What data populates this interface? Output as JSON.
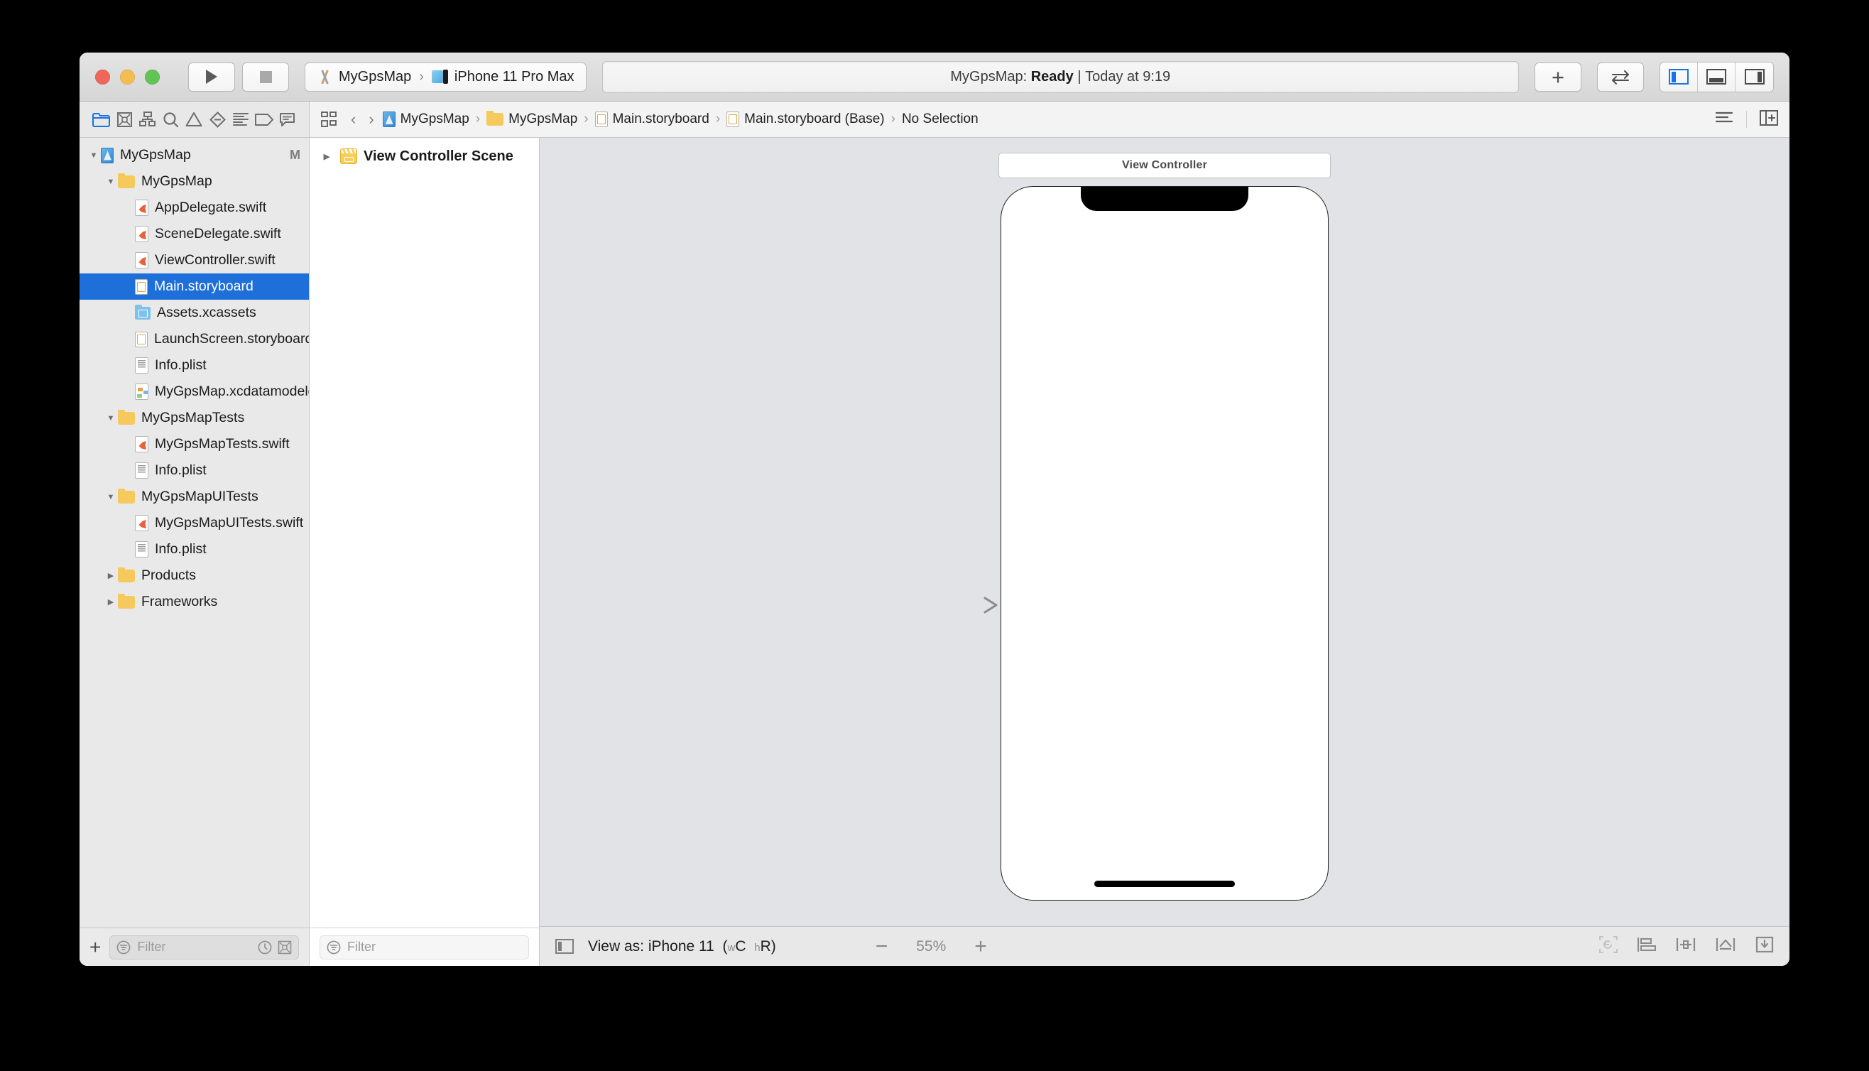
{
  "titlebar": {
    "run_button": "run",
    "stop_button": "stop",
    "scheme": {
      "project": "MyGpsMap",
      "destination": "iPhone 11 Pro Max",
      "separator": "›"
    },
    "status": {
      "prefix": "MyGpsMap:",
      "state": "Ready",
      "divider": "|",
      "time": "Today at 9:19"
    },
    "add_button": "+",
    "panel_toggles": [
      "navigator",
      "debug-area",
      "inspector"
    ]
  },
  "navigator_tabs": [
    {
      "name": "project-navigator",
      "active": true
    },
    {
      "name": "source-control-navigator",
      "active": false
    },
    {
      "name": "symbol-navigator",
      "active": false
    },
    {
      "name": "find-navigator",
      "active": false
    },
    {
      "name": "issue-navigator",
      "active": false
    },
    {
      "name": "test-navigator",
      "active": false
    },
    {
      "name": "debug-navigator",
      "active": false
    },
    {
      "name": "breakpoint-navigator",
      "active": false
    },
    {
      "name": "report-navigator",
      "active": false
    }
  ],
  "breadcrumb": {
    "separator": "›",
    "items": [
      {
        "label": "MyGpsMap",
        "icon": "project-icon"
      },
      {
        "label": "MyGpsMap",
        "icon": "folder-icon"
      },
      {
        "label": "Main.storyboard",
        "icon": "storyboard-icon"
      },
      {
        "label": "Main.storyboard (Base)",
        "icon": "storyboard-icon"
      },
      {
        "label": "No Selection",
        "icon": "none"
      }
    ]
  },
  "navigator": {
    "tree": [
      {
        "label": "MyGpsMap",
        "indent": 0,
        "icon": "project",
        "twisty": "open",
        "badge": "M",
        "selected": false
      },
      {
        "label": "MyGpsMap",
        "indent": 1,
        "icon": "folder",
        "twisty": "open",
        "badge": "",
        "selected": false
      },
      {
        "label": "AppDelegate.swift",
        "indent": 2,
        "icon": "swift",
        "twisty": "none",
        "badge": "",
        "selected": false
      },
      {
        "label": "SceneDelegate.swift",
        "indent": 2,
        "icon": "swift",
        "twisty": "none",
        "badge": "",
        "selected": false
      },
      {
        "label": "ViewController.swift",
        "indent": 2,
        "icon": "swift",
        "twisty": "none",
        "badge": "",
        "selected": false
      },
      {
        "label": "Main.storyboard",
        "indent": 2,
        "icon": "storyboard",
        "twisty": "none",
        "badge": "",
        "selected": true
      },
      {
        "label": "Assets.xcassets",
        "indent": 2,
        "icon": "xcassets",
        "twisty": "none",
        "badge": "",
        "selected": false
      },
      {
        "label": "LaunchScreen.storyboard",
        "indent": 2,
        "icon": "storyboard",
        "twisty": "none",
        "badge": "",
        "selected": false
      },
      {
        "label": "Info.plist",
        "indent": 2,
        "icon": "plist",
        "twisty": "none",
        "badge": "",
        "selected": false
      },
      {
        "label": "MyGpsMap.xcdatamodeld",
        "indent": 2,
        "icon": "xcdata",
        "twisty": "none",
        "badge": "",
        "selected": false
      },
      {
        "label": "MyGpsMapTests",
        "indent": 1,
        "icon": "folder",
        "twisty": "open",
        "badge": "",
        "selected": false
      },
      {
        "label": "MyGpsMapTests.swift",
        "indent": 2,
        "icon": "swift",
        "twisty": "none",
        "badge": "",
        "selected": false
      },
      {
        "label": "Info.plist",
        "indent": 2,
        "icon": "plist",
        "twisty": "none",
        "badge": "",
        "selected": false
      },
      {
        "label": "MyGpsMapUITests",
        "indent": 1,
        "icon": "folder",
        "twisty": "open",
        "badge": "",
        "selected": false
      },
      {
        "label": "MyGpsMapUITests.swift",
        "indent": 2,
        "icon": "swift",
        "twisty": "none",
        "badge": "",
        "selected": false
      },
      {
        "label": "Info.plist",
        "indent": 2,
        "icon": "plist",
        "twisty": "none",
        "badge": "",
        "selected": false
      },
      {
        "label": "Products",
        "indent": 1,
        "icon": "folder",
        "twisty": "closed",
        "badge": "",
        "selected": false
      },
      {
        "label": "Frameworks",
        "indent": 1,
        "icon": "folder",
        "twisty": "closed",
        "badge": "",
        "selected": false
      }
    ],
    "filter": {
      "placeholder": "Filter",
      "add_label": "+"
    }
  },
  "outline": {
    "items": [
      {
        "label": "View Controller Scene",
        "icon": "scene-icon",
        "twisty": "closed"
      }
    ],
    "filter": {
      "placeholder": "Filter"
    }
  },
  "canvas": {
    "scene_label": "View Controller",
    "device": "iPhone 11 Pro Max",
    "bottom_bar": {
      "view_as_prefix": "View as: iPhone 11",
      "size_class_w": "w",
      "size_class_w_val": "C",
      "size_class_h": "h",
      "size_class_h_val": "R",
      "zoom_out": "−",
      "zoom_level": "55%",
      "zoom_in": "+",
      "tools": [
        "update-frames",
        "align",
        "add-new-constraints",
        "resolve-auto-layout-issues",
        "embed-in"
      ]
    }
  },
  "colors": {
    "selection_blue": "#1e6fd9",
    "accent_blue": "#1473e6",
    "canvas_bg": "#e2e3e6",
    "chrome_bg": "#e8e8e8"
  }
}
